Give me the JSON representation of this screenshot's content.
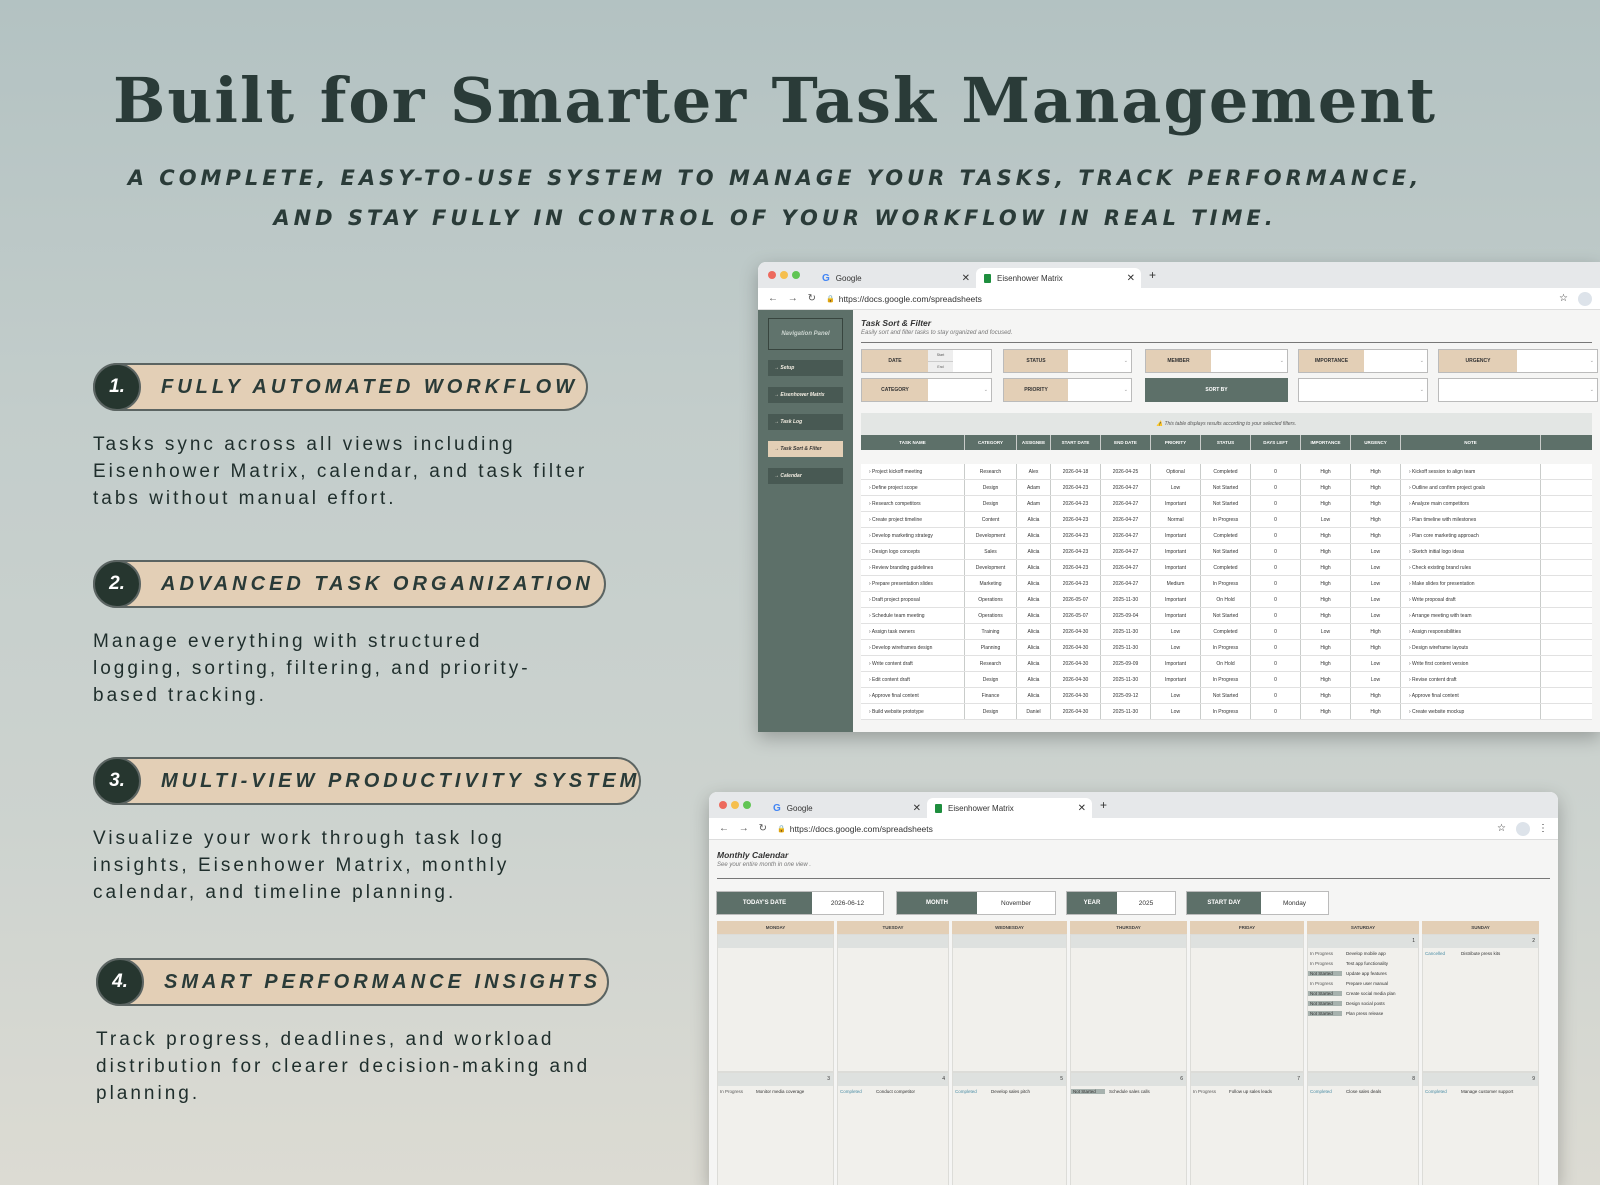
{
  "hero": {
    "title": "Built for Smarter Task Management",
    "subtitle": "A complete, easy-to-use system to manage your tasks, track performance, and stay fully in control of your workflow in real time."
  },
  "features": [
    {
      "num": "1.",
      "label": "Fully Automated Workflow",
      "desc": "Tasks sync across all views including Eisenhower Matrix, calendar, and task filter tabs without manual effort."
    },
    {
      "num": "2.",
      "label": "Advanced Task Organization",
      "desc": "Manage everything with structured logging, sorting, filtering, and priority-based tracking."
    },
    {
      "num": "3.",
      "label": "Multi-View Productivity System",
      "desc": "Visualize your work through task log insights, Eisenhower Matrix, monthly calendar, and timeline planning."
    },
    {
      "num": "4.",
      "label": "Smart Performance Insights",
      "desc": "Track progress, deadlines, and workload distribution for clearer decision-making and planning."
    }
  ],
  "browser": {
    "tab1": "Google",
    "tab2": "Eisenhower Matrix",
    "url": "https://docs.google.com/spreadsheets"
  },
  "sheet1": {
    "nav_panel": "Navigation Panel",
    "nav": [
      "Setup",
      "Eisenhower Matrix",
      "Task Log",
      "Task Sort & Filter",
      "Calendar"
    ],
    "title": "Task Sort & Filter",
    "subtitle": "Easily sort and filter tasks to stay organized and focused.",
    "filters": {
      "date": "DATE",
      "start": "Start",
      "end": "End",
      "status": "STATUS",
      "member": "MEMBER",
      "importance": "IMPORTANCE",
      "urgency": "URGENCY",
      "category": "CATEGORY",
      "priority": "PRIORITY",
      "sort_by": "SORT BY"
    },
    "note": "This table displays results according to your selected filters.",
    "columns": [
      "TASK NAME",
      "CATEGORY",
      "ASSIGNEE",
      "START DATE",
      "END DATE",
      "PRIORITY",
      "STATUS",
      "DAYS LEFT",
      "IMPORTANCE",
      "URGENCY",
      "NOTE"
    ],
    "rows": [
      [
        "Project kickoff meeting",
        "Research",
        "Alex",
        "2026-04-18",
        "2026-04-25",
        "Optional",
        "Completed",
        "0",
        "High",
        "High",
        "Kickoff session to align team"
      ],
      [
        "Define project scope",
        "Design",
        "Adam",
        "2026-04-23",
        "2026-04-27",
        "Low",
        "Not Started",
        "0",
        "High",
        "High",
        "Outline and confirm project goals"
      ],
      [
        "Research competitors",
        "Design",
        "Adam",
        "2026-04-23",
        "2026-04-27",
        "Important",
        "Not Started",
        "0",
        "High",
        "High",
        "Analyze main competitors"
      ],
      [
        "Create project timeline",
        "Content",
        "Alicia",
        "2026-04-23",
        "2026-04-27",
        "Normal",
        "In Progress",
        "0",
        "Low",
        "High",
        "Plan timeline with milestones"
      ],
      [
        "Develop marketing strategy",
        "Development",
        "Alicia",
        "2026-04-23",
        "2026-04-27",
        "Important",
        "Completed",
        "0",
        "High",
        "High",
        "Plan core marketing approach"
      ],
      [
        "Design logo concepts",
        "Sales",
        "Alicia",
        "2026-04-23",
        "2026-04-27",
        "Important",
        "Not Started",
        "0",
        "High",
        "Low",
        "Sketch initial logo ideas"
      ],
      [
        "Review branding guidelines",
        "Development",
        "Alicia",
        "2026-04-23",
        "2026-04-27",
        "Important",
        "Completed",
        "0",
        "High",
        "Low",
        "Check existing brand rules"
      ],
      [
        "Prepare presentation slides",
        "Marketing",
        "Alicia",
        "2026-04-23",
        "2026-04-27",
        "Medium",
        "In Progress",
        "0",
        "High",
        "Low",
        "Make slides for presentation"
      ],
      [
        "Draft project proposal",
        "Operations",
        "Alicia",
        "2026-05-07",
        "2025-11-30",
        "Important",
        "On Hold",
        "0",
        "High",
        "Low",
        "Write proposal draft"
      ],
      [
        "Schedule team meeting",
        "Operations",
        "Alicia",
        "2026-05-07",
        "2025-09-04",
        "Important",
        "Not Started",
        "0",
        "High",
        "Low",
        "Arrange meeting with team"
      ],
      [
        "Assign task owners",
        "Training",
        "Alicia",
        "2026-04-30",
        "2025-11-30",
        "Low",
        "Completed",
        "0",
        "Low",
        "High",
        "Assign responsibilities"
      ],
      [
        "Develop wireframes design",
        "Planning",
        "Alicia",
        "2026-04-30",
        "2025-11-30",
        "Low",
        "In Progress",
        "0",
        "High",
        "High",
        "Design wireframe layouts"
      ],
      [
        "Write content draft",
        "Research",
        "Alicia",
        "2026-04-30",
        "2025-09-09",
        "Important",
        "On Hold",
        "0",
        "High",
        "Low",
        "Write first content version"
      ],
      [
        "Edit content draft",
        "Design",
        "Alicia",
        "2026-04-30",
        "2025-11-30",
        "Important",
        "In Progress",
        "0",
        "High",
        "Low",
        "Revise content draft"
      ],
      [
        "Approve final content",
        "Finance",
        "Alicia",
        "2026-04-30",
        "2025-09-12",
        "Low",
        "Not Started",
        "0",
        "High",
        "High",
        "Approve final content"
      ],
      [
        "Build website prototype",
        "Design",
        "Daniel",
        "2026-04-30",
        "2025-11-30",
        "Low",
        "In Progress",
        "0",
        "High",
        "High",
        "Create website mockup"
      ]
    ]
  },
  "sheet2": {
    "title": "Monthly Calendar",
    "subtitle": "See your entire month in one view .",
    "today_label": "TODAY'S DATE",
    "today_value": "2026-06-12",
    "month_label": "MONTH",
    "month_value": "November",
    "year_label": "YEAR",
    "year_value": "2025",
    "startday_label": "START DAY",
    "startday_value": "Monday",
    "days": [
      "MONDAY",
      "TUESDAY",
      "WEDNESDAY",
      "THURSDAY",
      "FRIDAY",
      "SATURDAY",
      "SUNDAY"
    ],
    "week1": [
      {
        "date": "",
        "events": []
      },
      {
        "date": "",
        "events": []
      },
      {
        "date": "",
        "events": []
      },
      {
        "date": "",
        "events": []
      },
      {
        "date": "",
        "events": []
      },
      {
        "date": "1",
        "events": [
          {
            "status": "In Progress",
            "task": "Develop mobile app"
          },
          {
            "status": "In Progress",
            "task": "Test app functionality"
          },
          {
            "status": "Not Started",
            "task": "Update app features"
          },
          {
            "status": "In Progress",
            "task": "Prepare user manual"
          },
          {
            "status": "Not Started",
            "task": "Create social media plan"
          },
          {
            "status": "Not Started",
            "task": "Design social posts"
          },
          {
            "status": "Not Started",
            "task": "Plan press release"
          }
        ]
      },
      {
        "date": "2",
        "events": [
          {
            "status": "Cancelled",
            "task": "Distribute press kits"
          }
        ]
      }
    ],
    "week2": [
      {
        "date": "3",
        "events": [
          {
            "status": "In Progress",
            "task": "Monitor media coverage"
          }
        ]
      },
      {
        "date": "4",
        "events": [
          {
            "status": "Completed",
            "task": "Conduct competitor"
          }
        ]
      },
      {
        "date": "5",
        "events": [
          {
            "status": "Completed",
            "task": "Develop sales pitch"
          }
        ]
      },
      {
        "date": "6",
        "events": [
          {
            "status": "Not Started",
            "task": "Schedule sales calls"
          }
        ]
      },
      {
        "date": "7",
        "events": [
          {
            "status": "In Progress",
            "task": "Follow up sales leads"
          }
        ]
      },
      {
        "date": "8",
        "events": [
          {
            "status": "Completed",
            "task": "Close sales deals"
          }
        ]
      },
      {
        "date": "9",
        "events": [
          {
            "status": "Completed",
            "task": "Manage customer support"
          }
        ]
      }
    ]
  }
}
